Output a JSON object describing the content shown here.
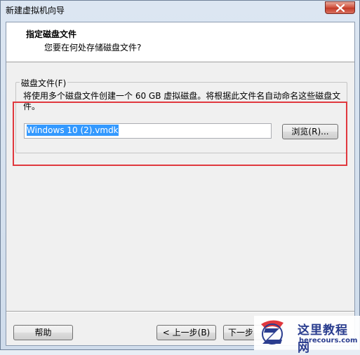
{
  "window": {
    "title": "新建虚拟机向导"
  },
  "header": {
    "title": "指定磁盘文件",
    "subtitle": "您要在何处存储磁盘文件?"
  },
  "disk_file": {
    "group_label": "磁盘文件(F)",
    "description": "将使用多个磁盘文件创建一个 60 GB 虚拟磁盘。将根据此文件名自动命名这些磁盘文件。",
    "path_value": "Windows 10 (2).vmdk",
    "browse_label": "浏览(R)..."
  },
  "footer": {
    "help_label": "帮助",
    "back_label": "< 上一步(B)",
    "next_label": "下一步"
  },
  "watermark": {
    "title": "这里教程网",
    "url": "herecours.com"
  },
  "colors": {
    "highlight": "#e0383e",
    "selection": "#3399ff",
    "brand": "#2a3d8f"
  }
}
